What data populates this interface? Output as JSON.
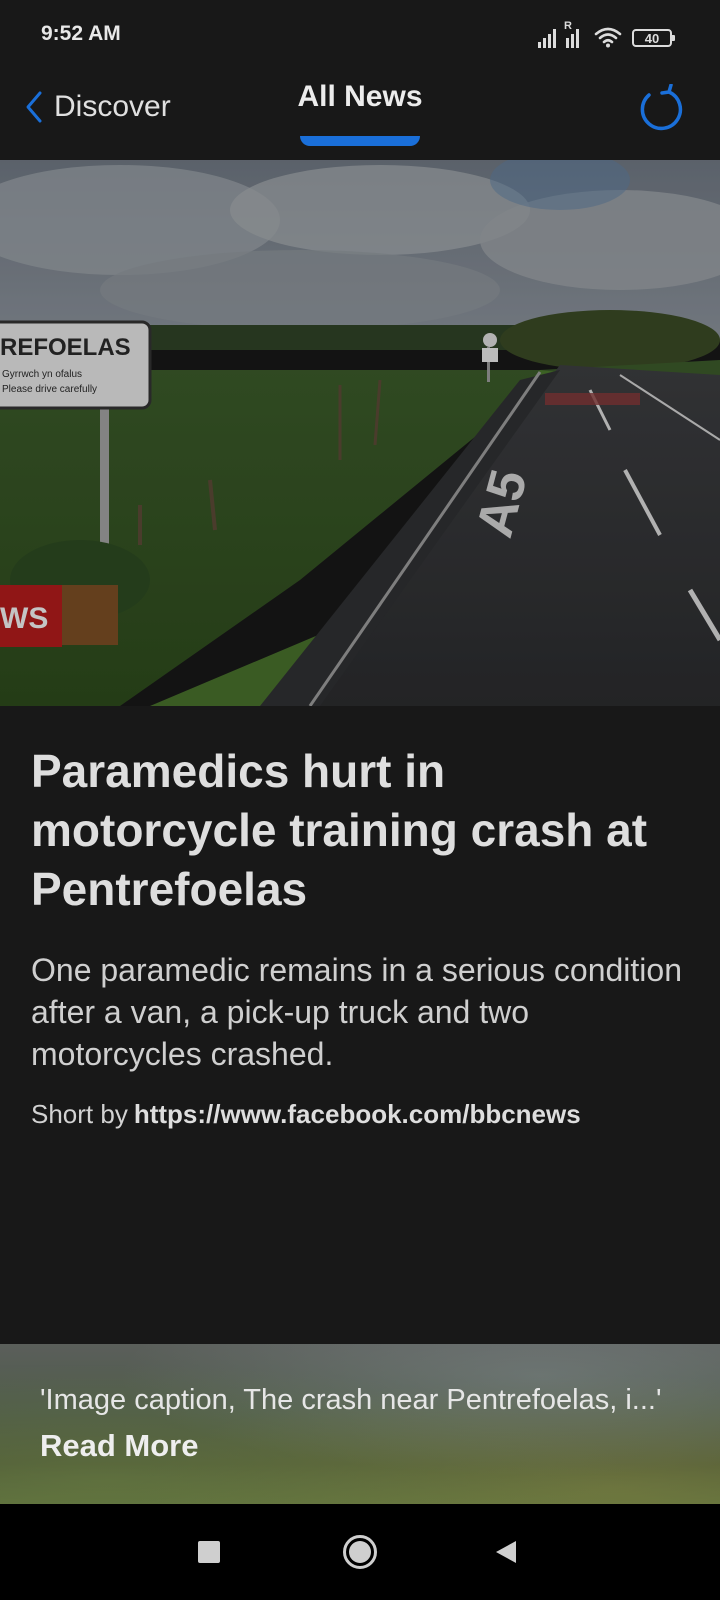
{
  "status_bar": {
    "time": "9:52 AM",
    "roaming_mark": "R",
    "battery": "40"
  },
  "nav": {
    "back_label": "Discover",
    "title": "All News",
    "accent_color": "#1a6fd9"
  },
  "hero_image": {
    "sign_name": "REFOELAS",
    "sign_line1": "Gyrrwch yn ofalus",
    "sign_line2": "Please drive carefully",
    "badge_text": "WS",
    "road_marking": "A5"
  },
  "article": {
    "headline": "Paramedics hurt in motorcycle training crash at Pentrefoelas",
    "summary": "One paramedic remains in a serious condition after a van, a pick-up truck and two motorcycles crashed.",
    "byline_prefix": "Short by",
    "byline_source": "https://www.facebook.com/bbcnews"
  },
  "footer": {
    "caption": "'Image caption, The crash near Pentrefoelas, i...'",
    "read_more": "Read More"
  }
}
